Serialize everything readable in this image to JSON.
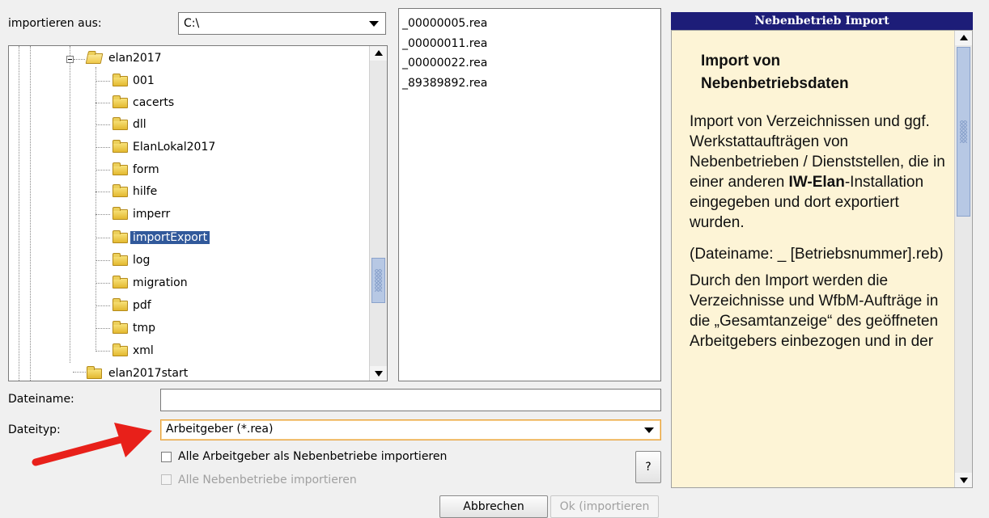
{
  "import_from": {
    "label": "importieren aus:",
    "drive": "C:\\"
  },
  "tree": {
    "items": [
      {
        "label": "elan2017",
        "expanded": true
      },
      {
        "label": "001"
      },
      {
        "label": "cacerts"
      },
      {
        "label": "dll"
      },
      {
        "label": "ElanLokal2017"
      },
      {
        "label": "form"
      },
      {
        "label": "hilfe"
      },
      {
        "label": "imperr"
      },
      {
        "label": "importExport",
        "selected": true
      },
      {
        "label": "log"
      },
      {
        "label": "migration"
      },
      {
        "label": "pdf"
      },
      {
        "label": "tmp"
      },
      {
        "label": "xml"
      },
      {
        "label": "elan2017start"
      }
    ]
  },
  "files": [
    "_00000005.rea",
    "_00000011.rea",
    "_00000022.rea",
    "_89389892.rea"
  ],
  "info": {
    "header": "Nebenbetrieb Import",
    "title_line1": "Import von",
    "title_line2": "Nebenbetriebsdaten",
    "p1_before": "Import von Verzeichnissen und ggf. Werkstattaufträgen von Nebenbetrieben / Dienststellen, die in einer anderen ",
    "p1_bold": "IW-Elan",
    "p1_after": "-Installation eingegeben und dort exportiert wurden.",
    "p2": "(Dateiname: _ [Betriebsnummer].reb)",
    "p3": "Durch den Import werden die Verzeichnisse und WfbM-Aufträge in die „Gesamtanzeige“ des geöffneten Arbeitgebers einbezogen und in der"
  },
  "filename": {
    "label": "Dateiname:",
    "value": ""
  },
  "filetype": {
    "label": "Dateityp:",
    "value": "Arbeitgeber (*.rea)"
  },
  "options": {
    "import_all_employers": "Alle Arbeitgeber als Nebenbetriebe importieren",
    "import_all_branches": "Alle Nebenbetriebe importieren"
  },
  "buttons": {
    "help": "?",
    "cancel": "Abbrechen",
    "ok": "Ok (importieren"
  },
  "colors": {
    "header_bg": "#1d1d78",
    "info_bg": "#fdf4d6",
    "selection": "#31599b",
    "arrow": "#e8201a",
    "filetype_border": "#e8a33a"
  }
}
